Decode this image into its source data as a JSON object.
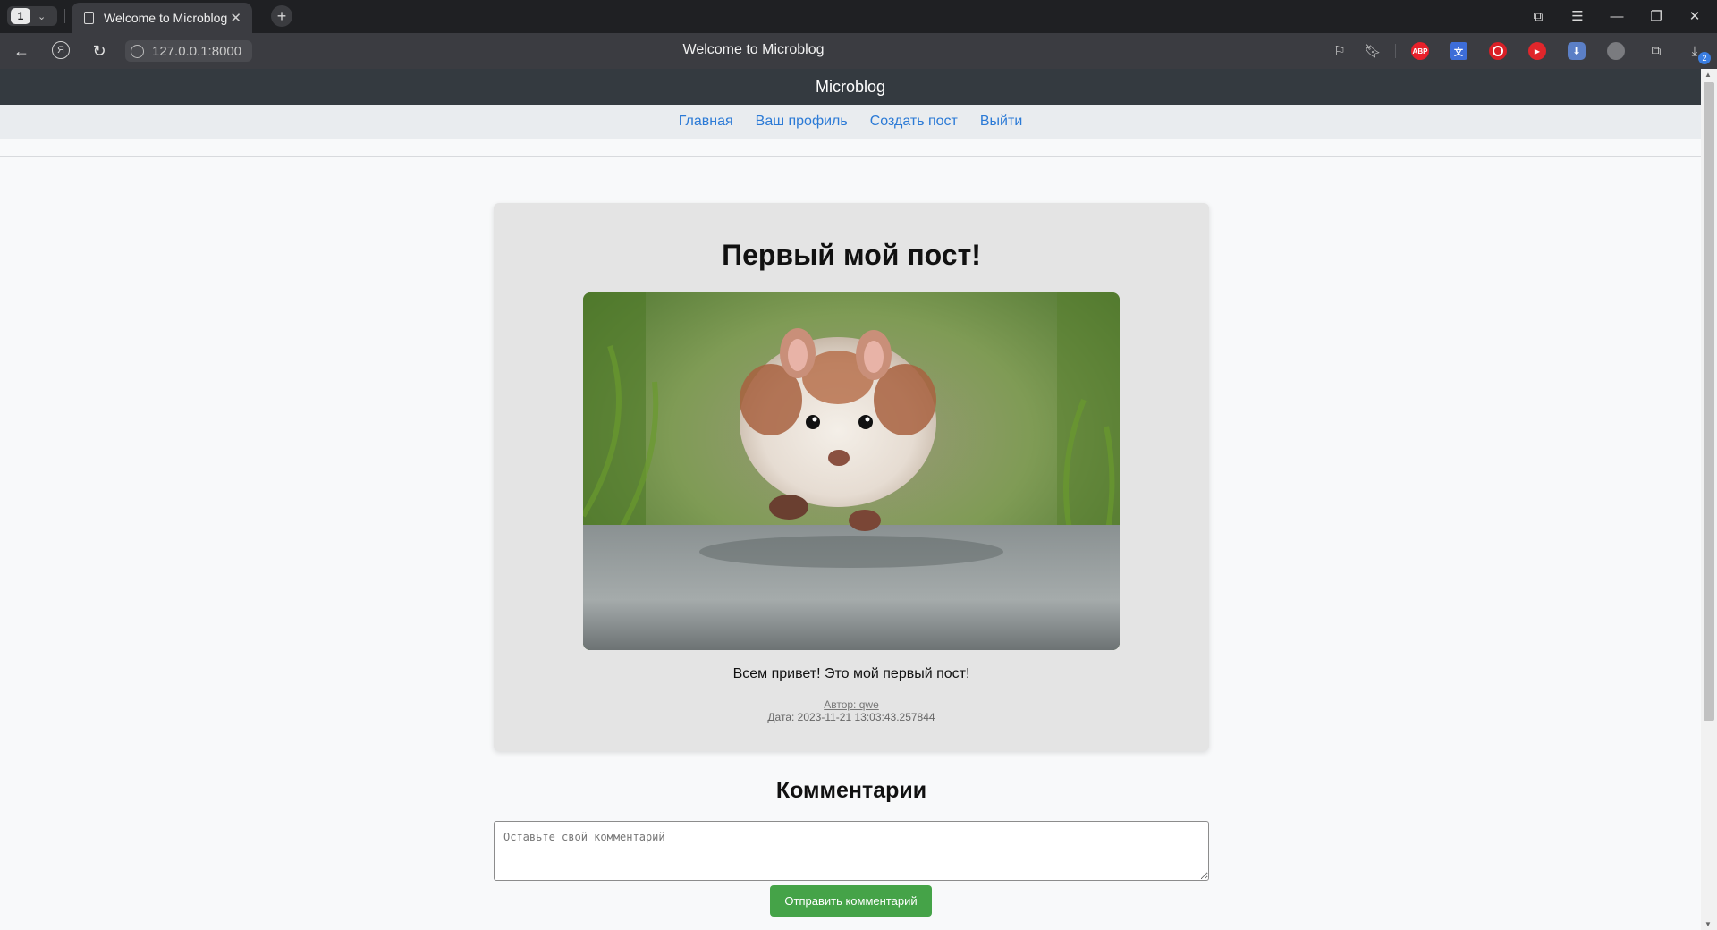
{
  "browser": {
    "tab_count": "1",
    "tab_title": "Welcome to Microblog",
    "url": "127.0.0.1:8000",
    "page_title": "Welcome to Microblog",
    "ya_label": "Я",
    "extensions": [
      "translate-icon",
      "bookmark-icon",
      "adblock-plus-icon",
      "translator-icon",
      "recorder-icon",
      "youtube-icon",
      "downloader-icon",
      "grey-extension-icon",
      "sidebar-icon",
      "downloads-icon"
    ],
    "abp_label": "ABP",
    "downloads_badge": "2"
  },
  "site": {
    "brand": "Microblog",
    "nav": [
      "Главная",
      "Ваш профиль",
      "Создать пост",
      "Выйти"
    ]
  },
  "post": {
    "title": "Первый мой пост!",
    "text": "Всем привет! Это мой первый пост!",
    "author": "Автор: qwe",
    "date": "Дата: 2023-11-21 13:03:43.257844"
  },
  "comments": {
    "title": "Комментарии",
    "placeholder": "Оставьте свой комментарий",
    "submit_label": "Отправить комментарий"
  }
}
